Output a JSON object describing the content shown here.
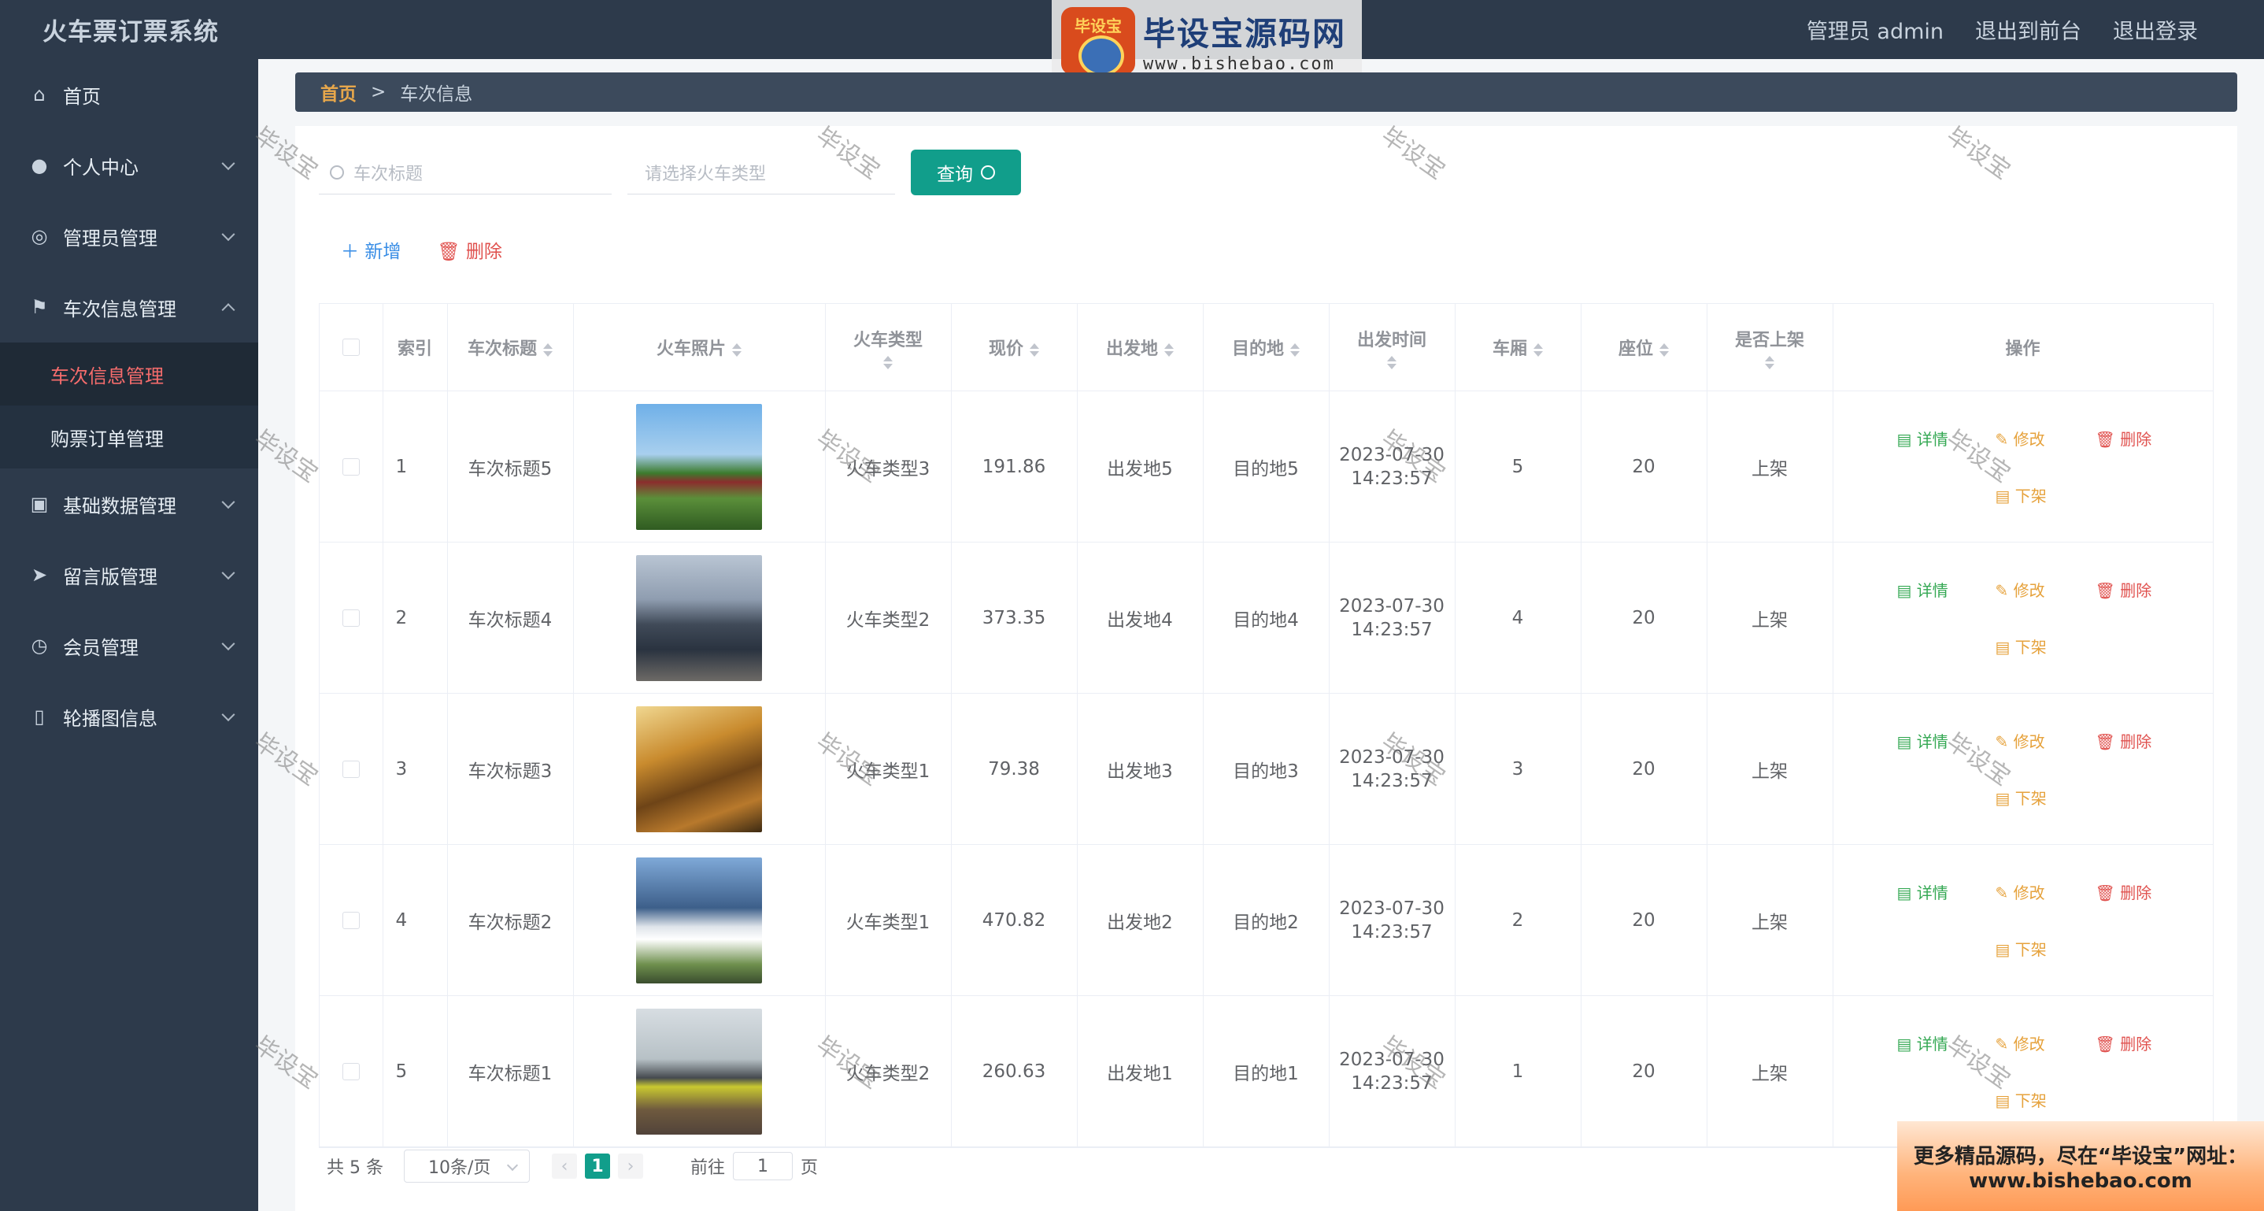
{
  "header": {
    "app_title": "火车票订票系统",
    "links": [
      "管理员 admin",
      "退出到前台",
      "退出登录"
    ]
  },
  "watermark_logo": {
    "seal_text": "毕设宝",
    "name": "毕设宝源码网",
    "url": "www.bishebao.com",
    "diagonal_text": "毕设宝"
  },
  "sidebar": {
    "items": [
      {
        "label": "首页",
        "icon": "home-icon"
      },
      {
        "label": "个人中心",
        "icon": "user-icon"
      },
      {
        "label": "管理员管理",
        "icon": "compass-icon"
      },
      {
        "label": "车次信息管理",
        "icon": "flag-icon",
        "expanded": true,
        "children": [
          {
            "label": "车次信息管理",
            "active": true
          },
          {
            "label": "购票订单管理"
          }
        ]
      },
      {
        "label": "基础数据管理",
        "icon": "clipboard-icon"
      },
      {
        "label": "留言版管理",
        "icon": "send-icon"
      },
      {
        "label": "会员管理",
        "icon": "gauge-icon"
      },
      {
        "label": "轮播图信息",
        "icon": "mobile-icon"
      }
    ]
  },
  "breadcrumb": {
    "home": "首页",
    "sep": ">",
    "current": "车次信息"
  },
  "search": {
    "title_placeholder": "车次标题",
    "type_placeholder": "请选择火车类型",
    "query_label": "查询"
  },
  "actions": {
    "add_label": "新增",
    "delete_label": "删除"
  },
  "table": {
    "columns": [
      "索引",
      "车次标题",
      "火车照片",
      "火车类型",
      "现价",
      "出发地",
      "目的地",
      "出发时间",
      "车厢",
      "座位",
      "是否上架",
      "操作"
    ],
    "op_labels": {
      "detail": "详情",
      "edit": "修改",
      "delete": "删除",
      "offshelf": "下架"
    },
    "rows": [
      {
        "index": "1",
        "title": "车次标题5",
        "photo": "train-photo-1",
        "type": "火车类型3",
        "price": "191.86",
        "from": "出发地5",
        "to": "目的地5",
        "date": "2023-07-30",
        "time": "14:23:57",
        "car": "5",
        "seat": "20",
        "status": "上架"
      },
      {
        "index": "2",
        "title": "车次标题4",
        "photo": "train-photo-2",
        "type": "火车类型2",
        "price": "373.35",
        "from": "出发地4",
        "to": "目的地4",
        "date": "2023-07-30",
        "time": "14:23:57",
        "car": "4",
        "seat": "20",
        "status": "上架"
      },
      {
        "index": "3",
        "title": "车次标题3",
        "photo": "train-photo-3",
        "type": "火车类型1",
        "price": "79.38",
        "from": "出发地3",
        "to": "目的地3",
        "date": "2023-07-30",
        "time": "14:23:57",
        "car": "3",
        "seat": "20",
        "status": "上架"
      },
      {
        "index": "4",
        "title": "车次标题2",
        "photo": "train-photo-4",
        "type": "火车类型1",
        "price": "470.82",
        "from": "出发地2",
        "to": "目的地2",
        "date": "2023-07-30",
        "time": "14:23:57",
        "car": "2",
        "seat": "20",
        "status": "上架"
      },
      {
        "index": "5",
        "title": "车次标题1",
        "photo": "train-photo-5",
        "type": "火车类型2",
        "price": "260.63",
        "from": "出发地1",
        "to": "目的地1",
        "date": "2023-07-30",
        "time": "14:23:57",
        "car": "1",
        "seat": "20",
        "status": "上架"
      }
    ]
  },
  "pagination": {
    "total_text": "共 5 条",
    "page_size": "10条/页",
    "current_page": "1",
    "goto_prefix": "前往",
    "goto_value": "1",
    "goto_suffix": "页"
  },
  "promo": {
    "line1": "更多精品源码，尽在“毕设宝”网址：",
    "line2": "www.bishebao.com"
  },
  "colors": {
    "sidebar_bg": "#2d3a4b",
    "accent": "#119e8b",
    "active_menu": "#f56c6c"
  }
}
